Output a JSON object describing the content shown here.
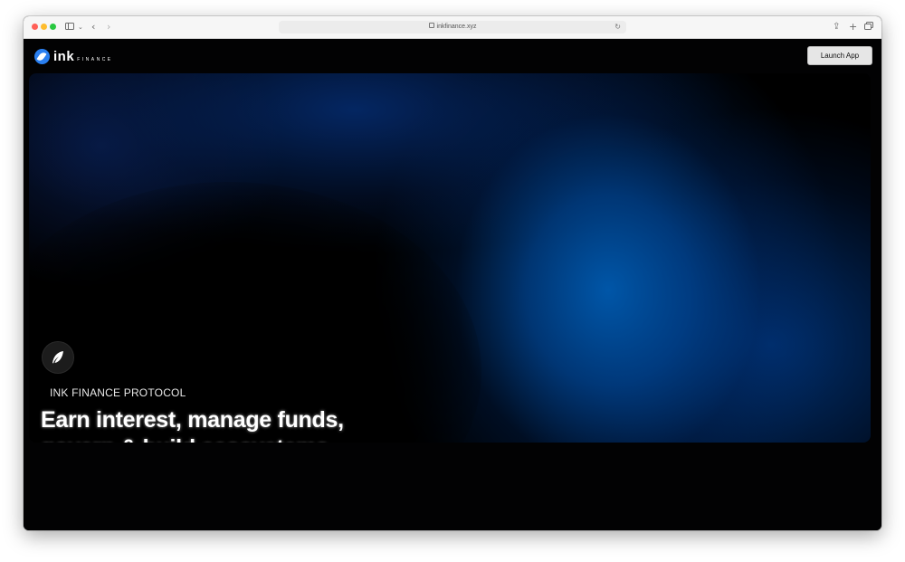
{
  "browser": {
    "url": "inkfinance.xyz",
    "icons": [
      "sidebar-icon",
      "chevron-down-icon",
      "back-icon",
      "forward-icon",
      "lock-icon",
      "reload-icon",
      "share-icon",
      "new-tab-icon",
      "tabs-icon"
    ]
  },
  "header": {
    "logo_text": "ink",
    "logo_subtext": "FINANCE",
    "launch_label": "Launch App"
  },
  "hero": {
    "kicker": "INK FINANCE PROTOCOL",
    "headline_line1": "Earn interest, manage funds,",
    "headline_line2": "govern & build ecosystems",
    "badge_icon": "feather-icon"
  },
  "colors": {
    "brand_blue": "#2a7ff0",
    "page_bg": "#020203",
    "gradient_blue": "#0058b0"
  }
}
